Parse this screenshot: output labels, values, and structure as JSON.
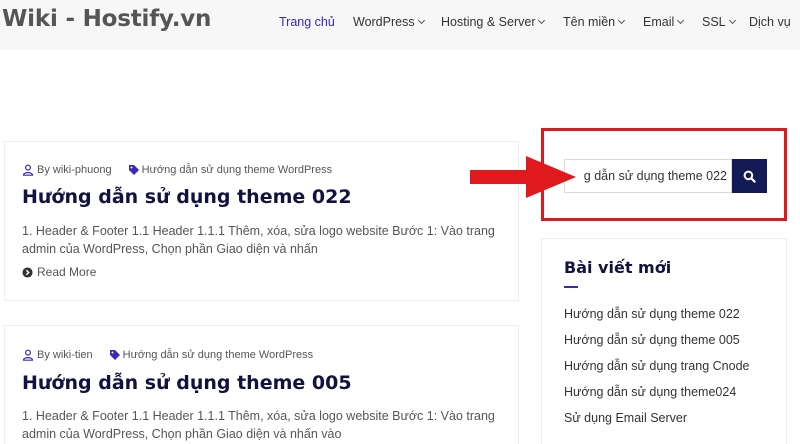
{
  "header": {
    "logo": "Wiki - Hostify.vn",
    "nav": [
      {
        "label": "Trang chủ",
        "active": true,
        "dropdown": false
      },
      {
        "label": "WordPress",
        "active": false,
        "dropdown": true
      },
      {
        "label": "Hosting & Server",
        "active": false,
        "dropdown": true
      },
      {
        "label": "Tên miền",
        "active": false,
        "dropdown": true
      },
      {
        "label": "Email",
        "active": false,
        "dropdown": true
      },
      {
        "label": "SSL",
        "active": false,
        "dropdown": true
      },
      {
        "label": "Dịch vụ",
        "active": false,
        "dropdown": false
      }
    ]
  },
  "posts": [
    {
      "author": "By wiki-phuong",
      "category": "Hướng dẫn sử dụng theme WordPress",
      "title": "Hướng dẫn sử dụng theme 022",
      "excerpt": "1.   Header & Footer   1.1 Header      1.1.1 Thêm, xóa, sửa logo website Bước 1: Vào  trang admin của WordPress, Chọn phần Giao diện và nhấn",
      "read_more": "Read More"
    },
    {
      "author": "By wiki-tien",
      "category": "Hướng dẫn sử dụng theme WordPress",
      "title": "Hướng dẫn sử dụng theme 005",
      "excerpt": "1. Header & Footer 1.1 Header 1.1.1 Thêm, xóa, sửa logo website Bước 1: Vào trang admin của WordPress, Chọn phần Giao diện và nhấn vào"
    }
  ],
  "search": {
    "value": "g dẫn sử dụng theme 022"
  },
  "widget": {
    "title": "Bài viết mới",
    "items": [
      "Hướng dẫn sử dụng theme 022",
      "Hướng dẫn sử dụng theme 005",
      "Hướng dẫn sử dụng trang Cnode",
      "Hướng dẫn sử dụng theme024",
      "Sử dụng Email Server"
    ]
  },
  "colors": {
    "accent": "#3d25b8",
    "title": "#12123e",
    "search_button": "#141a55",
    "highlight": "#e0191f"
  },
  "icons": [
    "user-icon",
    "tag-icon",
    "arrow-circle-right-icon",
    "search-icon",
    "chevron-down-icon",
    "red-arrow-icon"
  ]
}
